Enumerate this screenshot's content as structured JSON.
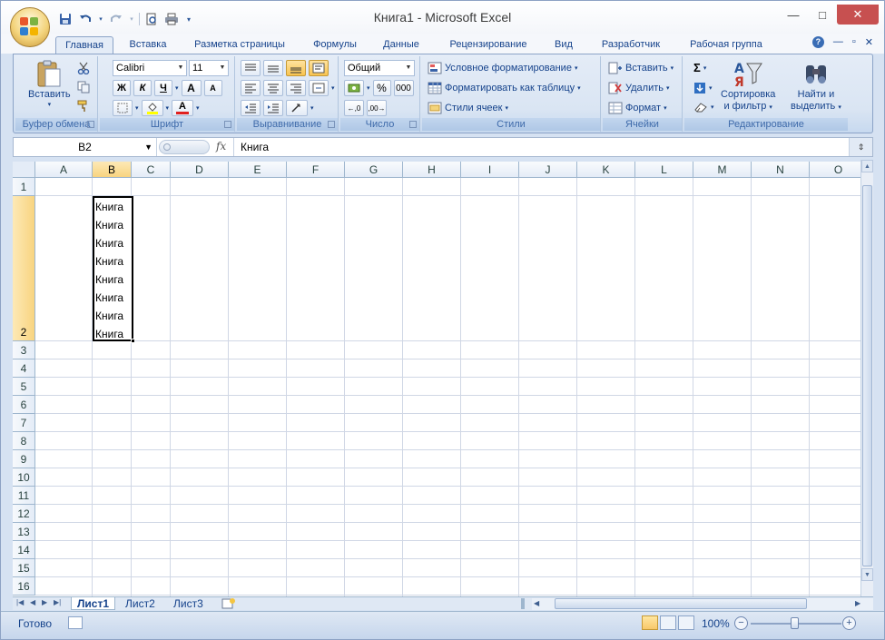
{
  "window": {
    "title": "Книга1 - Microsoft Excel",
    "close_glyph": "✕",
    "maximize_glyph": "□",
    "minimize_glyph": "—"
  },
  "tabs": [
    "Главная",
    "Вставка",
    "Разметка страницы",
    "Формулы",
    "Данные",
    "Рецензирование",
    "Вид",
    "Разработчик",
    "Рабочая группа"
  ],
  "active_tab": "Главная",
  "ribbon": {
    "clipboard": {
      "label": "Буфер обмена",
      "paste": "Вставить"
    },
    "font": {
      "label": "Шрифт",
      "font_name": "Calibri",
      "font_size": "11",
      "bold": "Ж",
      "italic": "К",
      "underline": "Ч",
      "grow": "A",
      "shrink": "A"
    },
    "alignment": {
      "label": "Выравнивание"
    },
    "number": {
      "label": "Число",
      "format": "Общий",
      "percent": "%",
      "thousands": "000"
    },
    "styles": {
      "label": "Стили",
      "conditional": "Условное форматирование",
      "as_table": "Форматировать как таблицу",
      "cell_styles": "Стили ячеек"
    },
    "cells": {
      "label": "Ячейки",
      "insert": "Вставить",
      "delete": "Удалить",
      "format": "Формат"
    },
    "editing": {
      "label": "Редактирование",
      "sum": "Σ",
      "sort_line1": "Сортировка",
      "sort_line2": "и фильтр",
      "find_line1": "Найти и",
      "find_line2": "выделить"
    }
  },
  "formula_bar": {
    "name_box": "B2",
    "fx": "fx",
    "value": "Книга"
  },
  "columns": [
    "A",
    "B",
    "C",
    "D",
    "E",
    "F",
    "G",
    "H",
    "I",
    "J",
    "K",
    "L",
    "M",
    "N",
    "O"
  ],
  "selected_column": "B",
  "rows": [
    "1",
    "2",
    "3",
    "4",
    "5",
    "6",
    "7",
    "8",
    "9",
    "10",
    "11",
    "12",
    "13",
    "14",
    "15",
    "16"
  ],
  "selected_row": "2",
  "cell_B2_lines": [
    "Книга",
    "Книга",
    "Книга",
    "Книга",
    "Книга",
    "Книга",
    "Книга",
    "Книга"
  ],
  "sheets": [
    "Лист1",
    "Лист2",
    "Лист3"
  ],
  "active_sheet": "Лист1",
  "status": {
    "ready": "Готово",
    "zoom": "100%"
  }
}
